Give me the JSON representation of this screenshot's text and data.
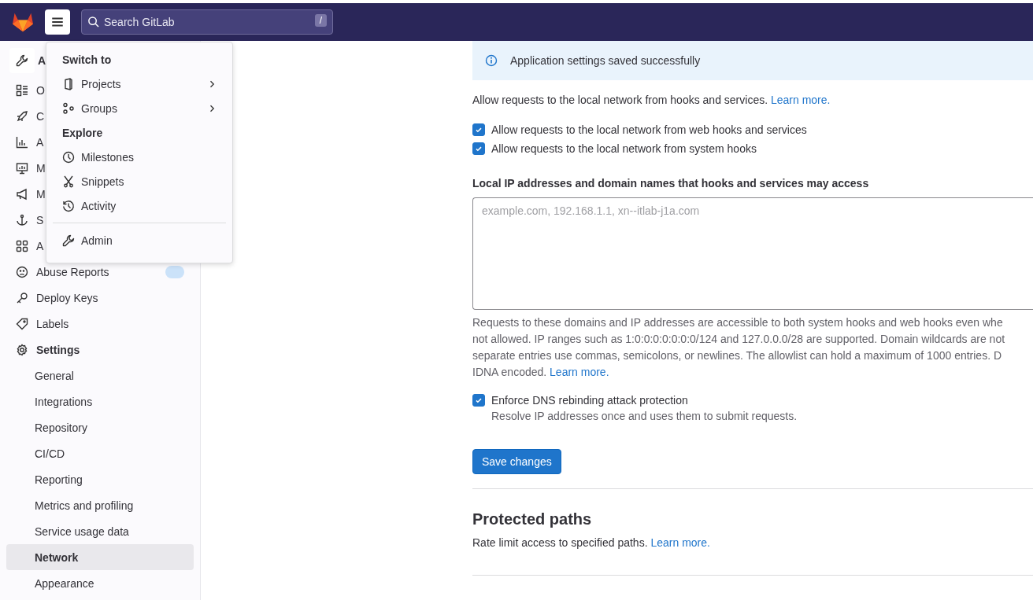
{
  "top_bar": {
    "search": {
      "placeholder": "Search GitLab",
      "shortcut": "/"
    }
  },
  "sidebar": {
    "header": "A",
    "items": [
      {
        "label": "O",
        "selected": false
      },
      {
        "label": "C",
        "selected": false
      },
      {
        "label": "A",
        "selected": false
      },
      {
        "label": "M",
        "selected": false
      },
      {
        "label": "M",
        "selected": false
      },
      {
        "label": "S",
        "selected": false
      },
      {
        "label": "A",
        "selected": false
      },
      {
        "label": "Abuse Reports",
        "selected": false,
        "badge": true
      },
      {
        "label": "Deploy Keys",
        "selected": false
      },
      {
        "label": "Labels",
        "selected": false
      },
      {
        "label": "Settings",
        "selected": false,
        "expanded": true,
        "children": [
          {
            "label": "General",
            "selected": false
          },
          {
            "label": "Integrations",
            "selected": false
          },
          {
            "label": "Repository",
            "selected": false
          },
          {
            "label": "CI/CD",
            "selected": false
          },
          {
            "label": "Reporting",
            "selected": false
          },
          {
            "label": "Metrics and profiling",
            "selected": false
          },
          {
            "label": "Service usage data",
            "selected": false
          },
          {
            "label": "Network",
            "selected": true
          },
          {
            "label": "Appearance",
            "selected": false
          }
        ]
      }
    ]
  },
  "menu": {
    "sections": [
      {
        "title": "Switch to",
        "items": [
          {
            "label": "Projects",
            "submenu": true
          },
          {
            "label": "Groups",
            "submenu": true
          }
        ]
      },
      {
        "title": "Explore",
        "items": [
          {
            "label": "Milestones",
            "submenu": false
          },
          {
            "label": "Snippets",
            "submenu": false
          },
          {
            "label": "Activity",
            "submenu": false
          }
        ]
      }
    ],
    "footer": {
      "label": "Admin"
    }
  },
  "alert": {
    "message": "Application settings saved successfully"
  },
  "intro": {
    "text": "Allow requests to the local network from hooks and services.",
    "link": "Learn more."
  },
  "checkboxes": [
    {
      "label": "Allow requests to the local network from web hooks and services",
      "checked": true
    },
    {
      "label": "Allow requests to the local network from system hooks",
      "checked": true
    }
  ],
  "allowlist": {
    "label": "Local IP addresses and domain names that hooks and services may access",
    "placeholder": "example.com, 192.168.1.1, xn--itlab-j1a.com",
    "help_lines": [
      "Requests to these domains and IP addresses are accessible to both system hooks and web hooks even whe",
      "not allowed. IP ranges such as 1:0:0:0:0:0:0:0/124 and 127.0.0.0/28 are supported. Domain wildcards are not",
      "separate entries use commas, semicolons, or newlines. The allowlist can hold a maximum of 1000 entries. D",
      "IDNA encoded."
    ],
    "help_link": "Learn more."
  },
  "dns": {
    "label": "Enforce DNS rebinding attack protection",
    "hint": "Resolve IP addresses once and uses them to submit requests.",
    "checked": true
  },
  "save_button": "Save changes",
  "protected_paths": {
    "title": "Protected paths",
    "text": "Rate limit access to specified paths.",
    "link": "Learn more."
  }
}
